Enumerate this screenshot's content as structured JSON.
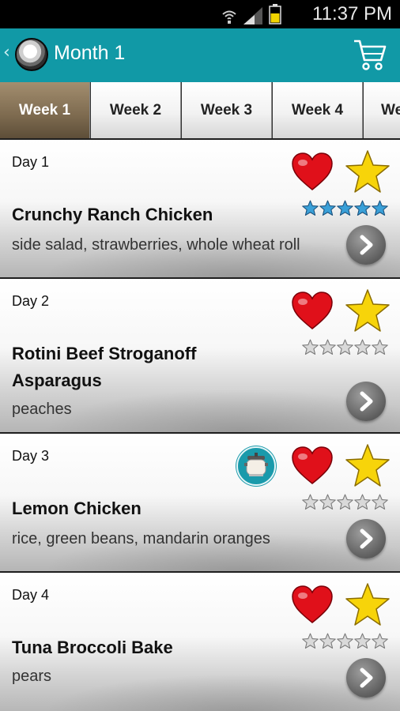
{
  "status_bar": {
    "time": "11:37 PM"
  },
  "header": {
    "title": "Month 1"
  },
  "tabs": [
    {
      "label": "Week 1",
      "active": true
    },
    {
      "label": "Week 2",
      "active": false
    },
    {
      "label": "Week 3",
      "active": false
    },
    {
      "label": "Week 4",
      "active": false
    },
    {
      "label": "We",
      "active": false
    }
  ],
  "days": [
    {
      "day": "Day 1",
      "meal": "Crunchy Ranch Chicken",
      "sides": "side salad, strawberries, whole wheat roll",
      "rating": 5,
      "slow_cooker": false
    },
    {
      "day": "Day 2",
      "meal": "Rotini Beef Stroganoff\nAsparagus",
      "sides": "peaches",
      "rating": 0,
      "slow_cooker": false
    },
    {
      "day": "Day 3",
      "meal": "Lemon Chicken",
      "sides": "rice, green beans, mandarin oranges",
      "rating": 0,
      "slow_cooker": true
    },
    {
      "day": "Day 4",
      "meal": "Tuna Broccoli Bake",
      "sides": "pears",
      "rating": 0,
      "slow_cooker": false
    }
  ],
  "colors": {
    "action_bar": "#1199a6",
    "heart": "#e0101a",
    "star": "#f7d40a",
    "rating_filled": "#3aa0d8",
    "rating_empty": "#d9d9d9"
  }
}
